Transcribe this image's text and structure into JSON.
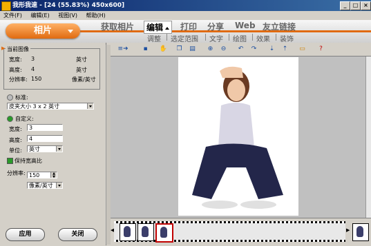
{
  "window": {
    "title": "我形我速 - [24 (55.83%) 450x600]",
    "min_label": "_",
    "max_label": "□",
    "close_label": "×"
  },
  "menu": [
    "文件(F)",
    "编辑(E)",
    "视图(V)",
    "帮助(H)"
  ],
  "photo_button": "相片",
  "main_tabs": [
    "获取相片",
    "编辑",
    "打印",
    "分享",
    "Web",
    "友立链接"
  ],
  "sub_tabs": [
    "调整",
    "选定范围",
    "文字",
    "绘图",
    "效果",
    "装饰"
  ],
  "panel": {
    "group_title": "当前图像",
    "width_label": "宽度:",
    "width_value": "3",
    "width_unit": "英寸",
    "height_label": "高度:",
    "height_value": "4",
    "height_unit": "英寸",
    "res_label": "分辨率:",
    "res_value": "150",
    "res_unit": "像素/英寸",
    "standard_label": "标准:",
    "standard_select": "皮夹大小 3 x 2 英寸",
    "custom_label": "自定义:",
    "c_width_label": "宽度:",
    "c_width_value": "3",
    "c_height_label": "高度:",
    "c_height_value": "4",
    "unit_label": "单位:",
    "unit_value": "英寸",
    "keep_ratio_label": "保持宽高比",
    "resolution_label": "分辨率:",
    "resolution_value": "150",
    "resolution_unit": "像素/英寸",
    "apply_button": "应用",
    "close_button": "关闭"
  },
  "colors": {
    "accent": "#e06a10",
    "title_bar": "#0a246a",
    "check": "#2a9a2a"
  }
}
